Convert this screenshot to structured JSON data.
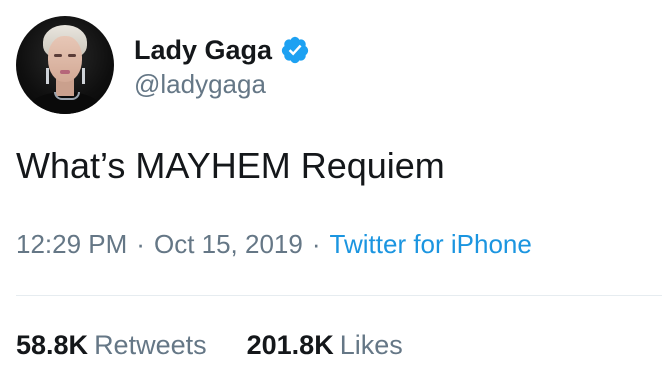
{
  "user": {
    "display_name": "Lady Gaga",
    "handle": "@ladygaga",
    "verified_icon": "verified-badge-icon",
    "verified_color": "#1da1f2"
  },
  "tweet": {
    "text": "What’s MAYHEM Requiem"
  },
  "meta": {
    "time": "12:29 PM",
    "separator": "·",
    "date": "Oct 15, 2019",
    "source": "Twitter for iPhone",
    "source_color": "#1b95e0"
  },
  "stats": {
    "retweets_count": "58.8K",
    "retweets_label": "Retweets",
    "likes_count": "201.8K",
    "likes_label": "Likes"
  },
  "colors": {
    "text_primary": "#14171a",
    "text_secondary": "#657786",
    "divider": "#e6ecf0",
    "background": "#ffffff"
  }
}
